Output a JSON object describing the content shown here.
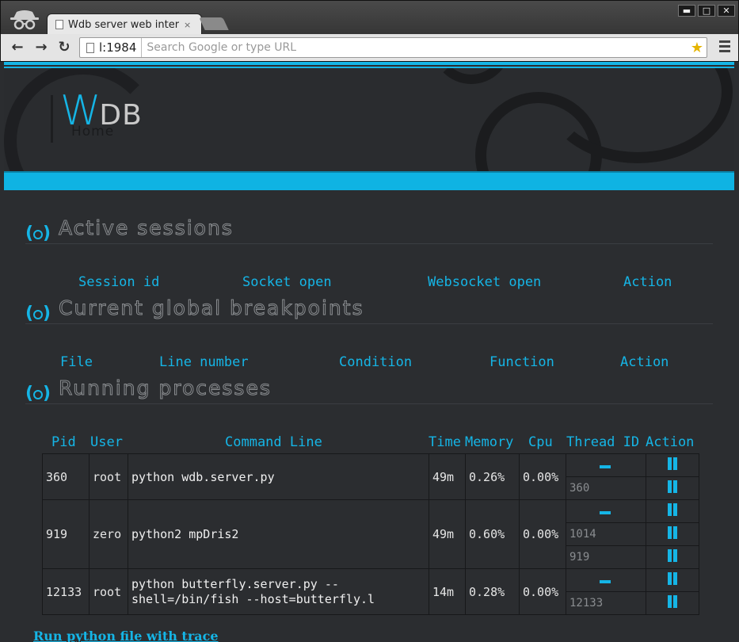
{
  "browser": {
    "tab_title": "Wdb server web interface",
    "tab_close": "×",
    "url_host": "l:1984",
    "omnibox_placeholder": "Search Google or type URL",
    "win_minimize": "▬",
    "win_maximize": "□",
    "win_close": "✕"
  },
  "header": {
    "logo_w": "W",
    "logo_db": "DB",
    "home": "Home"
  },
  "sections": {
    "active": {
      "title": "Active sessions",
      "columns": [
        "Session id",
        "Socket open",
        "Websocket open",
        "Action"
      ]
    },
    "breakpoints": {
      "title": "Current global breakpoints",
      "columns": [
        "File",
        "Line number",
        "Condition",
        "Function",
        "Action"
      ]
    },
    "processes": {
      "title": "Running processes",
      "columns": [
        "Pid",
        "User",
        "Command Line",
        "Time",
        "Memory",
        "Cpu",
        "Thread ID",
        "Action"
      ],
      "rows": [
        {
          "pid": "360",
          "user": "root",
          "cmd": "python wdb.server.py",
          "time": "49m",
          "mem": "0.26%",
          "cpu": "0.00%",
          "threads": [
            "360"
          ]
        },
        {
          "pid": "919",
          "user": "zero",
          "cmd": "python2 mpDris2",
          "time": "49m",
          "mem": "0.60%",
          "cpu": "0.00%",
          "threads": [
            "1014",
            "919"
          ]
        },
        {
          "pid": "12133",
          "user": "root",
          "cmd": "python butterfly.server.py --shell=/bin/fish --host=butterfly.l",
          "time": "14m",
          "mem": "0.28%",
          "cpu": "0.00%",
          "threads": [
            "12133"
          ]
        }
      ]
    }
  },
  "footer": {
    "run_link": "Run python file with trace"
  },
  "colors": {
    "accent": "#15b5e6",
    "background": "#2b2d30"
  }
}
